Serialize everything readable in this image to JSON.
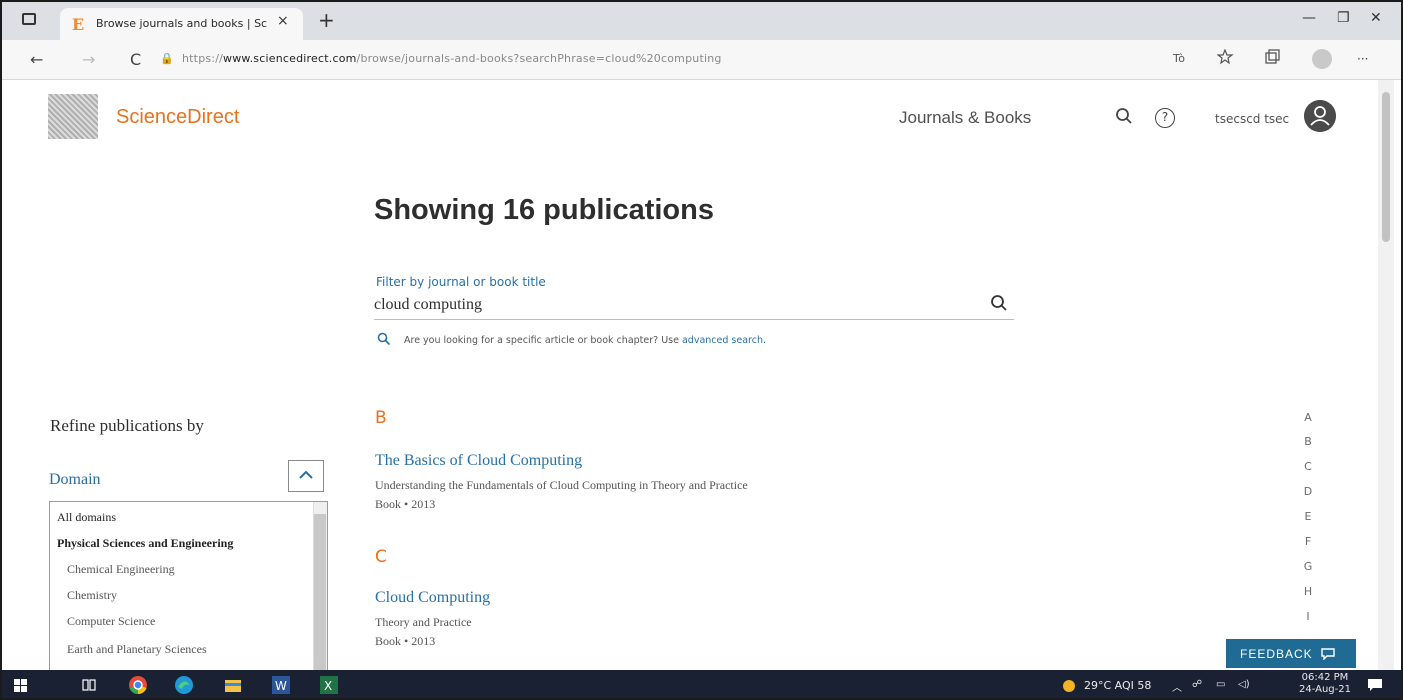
{
  "browser": {
    "tab_favicon": "E",
    "tab_title": "Browse journals and books | Scie",
    "tab_close": "×",
    "new_tab": "+",
    "minimize": "—",
    "maximize": "❐",
    "close": "✕",
    "url_prefix": "https://",
    "url_host": "www.sciencedirect.com",
    "url_path": "/browse/journals-and-books?searchPhrase=cloud%20computing",
    "back": "←",
    "forward": "→",
    "reload": "C",
    "lock": "🔒",
    "more": "···"
  },
  "header": {
    "brand": "ScienceDirect",
    "journals_link": "Journals & Books",
    "help": "?",
    "user_name": "tsecscd tsec"
  },
  "main": {
    "heading": "Showing 16 publications",
    "filter_label": "Filter by journal or book title",
    "filter_value": "cloud computing",
    "hint_text": "Are you looking for a specific article or book chapter? Use ",
    "hint_link": "advanced search."
  },
  "publications": [
    {
      "letter": "B",
      "title": "The Basics of Cloud Computing",
      "subtitle": "Understanding the Fundamentals of Cloud Computing in Theory and Practice",
      "meta": "Book • 2013"
    },
    {
      "letter": "C",
      "title": "Cloud Computing",
      "subtitle": "Theory and Practice",
      "meta": "Book • 2013"
    }
  ],
  "refine": {
    "heading": "Refine publications by",
    "domain_label": "Domain",
    "domains": [
      "All domains",
      "Physical Sciences and Engineering",
      "Chemical Engineering",
      "Chemistry",
      "Computer Science",
      "Earth and Planetary Sciences"
    ]
  },
  "alphabet": [
    "A",
    "B",
    "C",
    "D",
    "E",
    "F",
    "G",
    "H",
    "I"
  ],
  "feedback": "FEEDBACK",
  "taskbar": {
    "weather": "29°C AQI 58",
    "time": "06:42 PM",
    "date": "24-Aug-21"
  },
  "colors": {
    "brand_orange": "#e9711c",
    "link_blue": "#2770a6",
    "feedback_bg": "#1f6b94",
    "taskbar_bg": "#1a2132"
  }
}
